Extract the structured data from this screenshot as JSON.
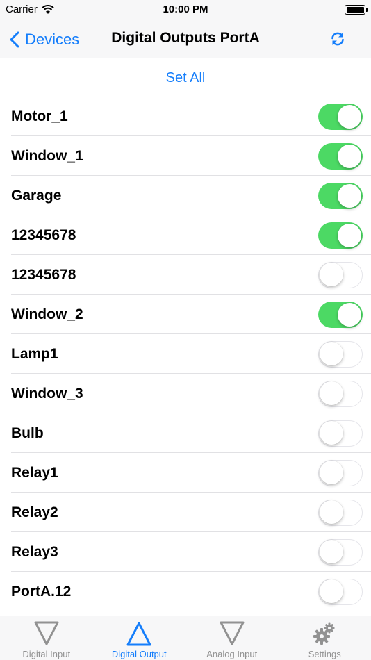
{
  "status_bar": {
    "carrier": "Carrier",
    "time": "10:00 PM"
  },
  "nav": {
    "back_label": "Devices",
    "title": "Digital Outputs PortA"
  },
  "set_all_label": "Set All",
  "outputs": [
    {
      "label": "Motor_1",
      "on": true
    },
    {
      "label": "Window_1",
      "on": true
    },
    {
      "label": "Garage",
      "on": true
    },
    {
      "label": "12345678",
      "on": true
    },
    {
      "label": "12345678",
      "on": false
    },
    {
      "label": "Window_2",
      "on": true
    },
    {
      "label": "Lamp1",
      "on": false
    },
    {
      "label": "Window_3",
      "on": false
    },
    {
      "label": "Bulb",
      "on": false
    },
    {
      "label": "Relay1",
      "on": false
    },
    {
      "label": "Relay2",
      "on": false
    },
    {
      "label": "Relay3",
      "on": false
    },
    {
      "label": "PortA.12",
      "on": false
    }
  ],
  "tabs": [
    {
      "label": "Digital Input",
      "icon": "down-triangle-icon",
      "active": false
    },
    {
      "label": "Digital Output",
      "icon": "up-triangle-icon",
      "active": true
    },
    {
      "label": "Analog Input",
      "icon": "down-triangle-icon",
      "active": false
    },
    {
      "label": "Settings",
      "icon": "gears-icon",
      "active": false
    }
  ],
  "colors": {
    "accent": "#157efb",
    "toggle_on": "#4cd964",
    "inactive_tab": "#929292"
  }
}
